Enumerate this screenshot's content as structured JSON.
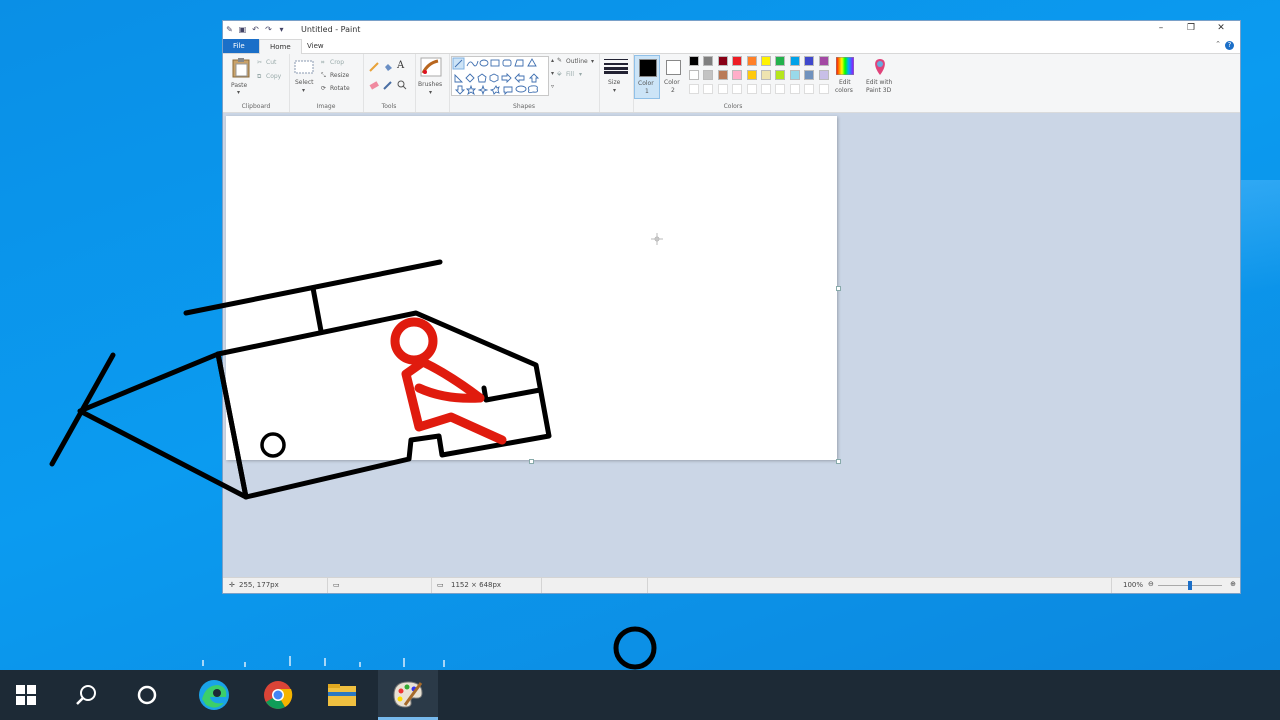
{
  "window": {
    "title": "Untitled - Paint",
    "controls": [
      "–",
      "❐",
      "✕"
    ],
    "tabs": {
      "file": "File",
      "home": "Home",
      "view": "View"
    },
    "help": "?"
  },
  "ribbon": {
    "clipboard": {
      "label": "Clipboard",
      "paste": "Paste",
      "cut": "Cut",
      "copy": "Copy"
    },
    "image": {
      "label": "Image",
      "select": "Select",
      "crop": "Crop",
      "resize": "Resize",
      "rotate": "Rotate"
    },
    "tools": {
      "label": "Tools"
    },
    "brushes": {
      "label": "Brushes"
    },
    "shapes": {
      "label": "Shapes",
      "outline": "Outline",
      "fill": "Fill"
    },
    "size": {
      "label": "Size"
    },
    "color1": {
      "label_a": "Color",
      "label_b": "1"
    },
    "color2": {
      "label_a": "Color",
      "label_b": "2"
    },
    "colors": {
      "label": "Colors",
      "edit_a": "Edit",
      "edit_b": "colors",
      "paint3d_a": "Edit with",
      "paint3d_b": "Paint 3D",
      "row1": [
        "#000000",
        "#7f7f7f",
        "#880015",
        "#ed1c24",
        "#ff7f27",
        "#fff200",
        "#22b14c",
        "#00a2e8",
        "#3f48cc",
        "#a349a4"
      ],
      "row2": [
        "#ffffff",
        "#c3c3c3",
        "#b97a57",
        "#ffaec9",
        "#ffc90e",
        "#efe4b0",
        "#b5e61d",
        "#99d9ea",
        "#7092be",
        "#c8bfe7"
      ],
      "row3": [
        "#ffffff",
        "#ffffff",
        "#ffffff",
        "#ffffff",
        "#ffffff",
        "#ffffff",
        "#ffffff",
        "#ffffff",
        "#ffffff",
        "#ffffff"
      ]
    }
  },
  "status": {
    "cursor": "255, 177px",
    "canvas_size": "1152 × 648px",
    "zoom": "100%"
  },
  "taskbar": {
    "items": [
      "start-icon",
      "search-icon",
      "cortana-icon",
      "edge-icon",
      "chrome-icon",
      "file-explorer-icon",
      "paint-icon"
    ]
  },
  "colors": {
    "accent": "#1b6fc8",
    "stroke": "#000000",
    "figure": "#e01b0e"
  }
}
